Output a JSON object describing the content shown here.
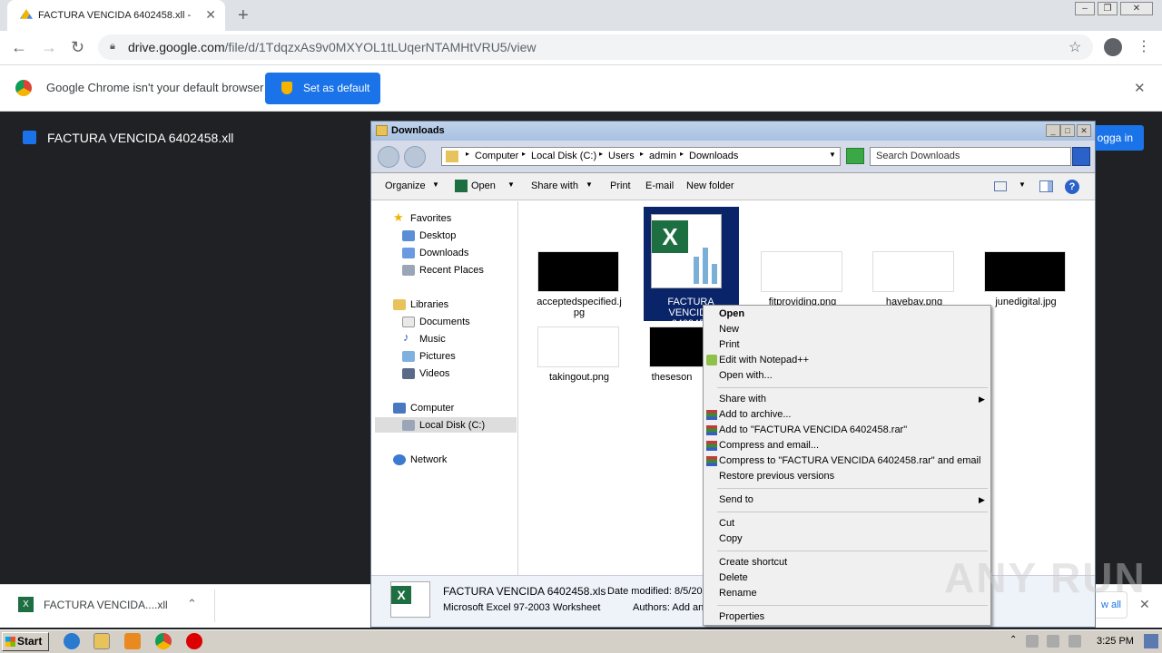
{
  "chrome": {
    "tab_title": "FACTURA VENCIDA 6402458.xll - Google Drive",
    "url_host": "drive.google.com",
    "url_path": "/file/d/1TdqzxAs9v0MXYOL1tLUqerNTAMHtVRU5/view",
    "infobar_text": "Google Chrome isn't your default browser",
    "set_default_label": "Set as default"
  },
  "drive": {
    "file_title": "FACTURA VENCIDA 6402458.xll",
    "login_label": "ogga in"
  },
  "download_bar": {
    "item_name": "FACTURA VENCIDA....xll",
    "show_all": "w all"
  },
  "explorer": {
    "title": "Downloads",
    "breadcrumbs": [
      "Computer",
      "Local Disk (C:)",
      "Users",
      "admin",
      "Downloads"
    ],
    "search_placeholder": "Search Downloads",
    "commands": [
      "Organize",
      "Open",
      "Share with",
      "Print",
      "E-mail",
      "New folder"
    ],
    "nav": {
      "favorites": "Favorites",
      "favorites_items": [
        "Desktop",
        "Downloads",
        "Recent Places"
      ],
      "libraries": "Libraries",
      "libraries_items": [
        "Documents",
        "Music",
        "Pictures",
        "Videos"
      ],
      "computer": "Computer",
      "computer_items": [
        "Local Disk (C:)"
      ],
      "network": "Network"
    },
    "files": [
      {
        "name": "acceptedspecified.jpg",
        "line1": "acceptedspecified.j",
        "line2": "pg"
      },
      {
        "name": "FACTURA VENCIDA 6402458.xls",
        "line1": "FACTURA VENCIDA",
        "line2": "6402458"
      },
      {
        "name": "fitproviding.png",
        "line1": "fitproviding.png",
        "line2": ""
      },
      {
        "name": "havebay.png",
        "line1": "havebay.png",
        "line2": ""
      },
      {
        "name": "junedigital.jpg",
        "line1": "junedigital.jpg",
        "line2": ""
      },
      {
        "name": "takingout.png",
        "line1": "takingout.png",
        "line2": ""
      },
      {
        "name": "theseson",
        "line1": "theseson",
        "line2": ""
      }
    ],
    "details": {
      "filename": "FACTURA VENCIDA 6402458.xls",
      "date_modified": "Date modified: 8/5/20",
      "type": "Microsoft Excel 97-2003 Worksheet",
      "authors": "Authors: Add an"
    }
  },
  "context_menu": {
    "open": "Open",
    "new": "New",
    "print": "Print",
    "edit_npp": "Edit with Notepad++",
    "open_with": "Open with...",
    "share_with": "Share with",
    "add_archive": "Add to archive...",
    "add_rar": "Add to \"FACTURA VENCIDA 6402458.rar\"",
    "compress_email": "Compress and email...",
    "compress_rar_email": "Compress to \"FACTURA VENCIDA 6402458.rar\" and email",
    "restore": "Restore previous versions",
    "send_to": "Send to",
    "cut": "Cut",
    "copy": "Copy",
    "create_shortcut": "Create shortcut",
    "delete": "Delete",
    "rename": "Rename",
    "properties": "Properties"
  },
  "taskbar": {
    "start_label": "Start",
    "clock": "3:25 PM"
  },
  "watermark": "ANY RUN"
}
